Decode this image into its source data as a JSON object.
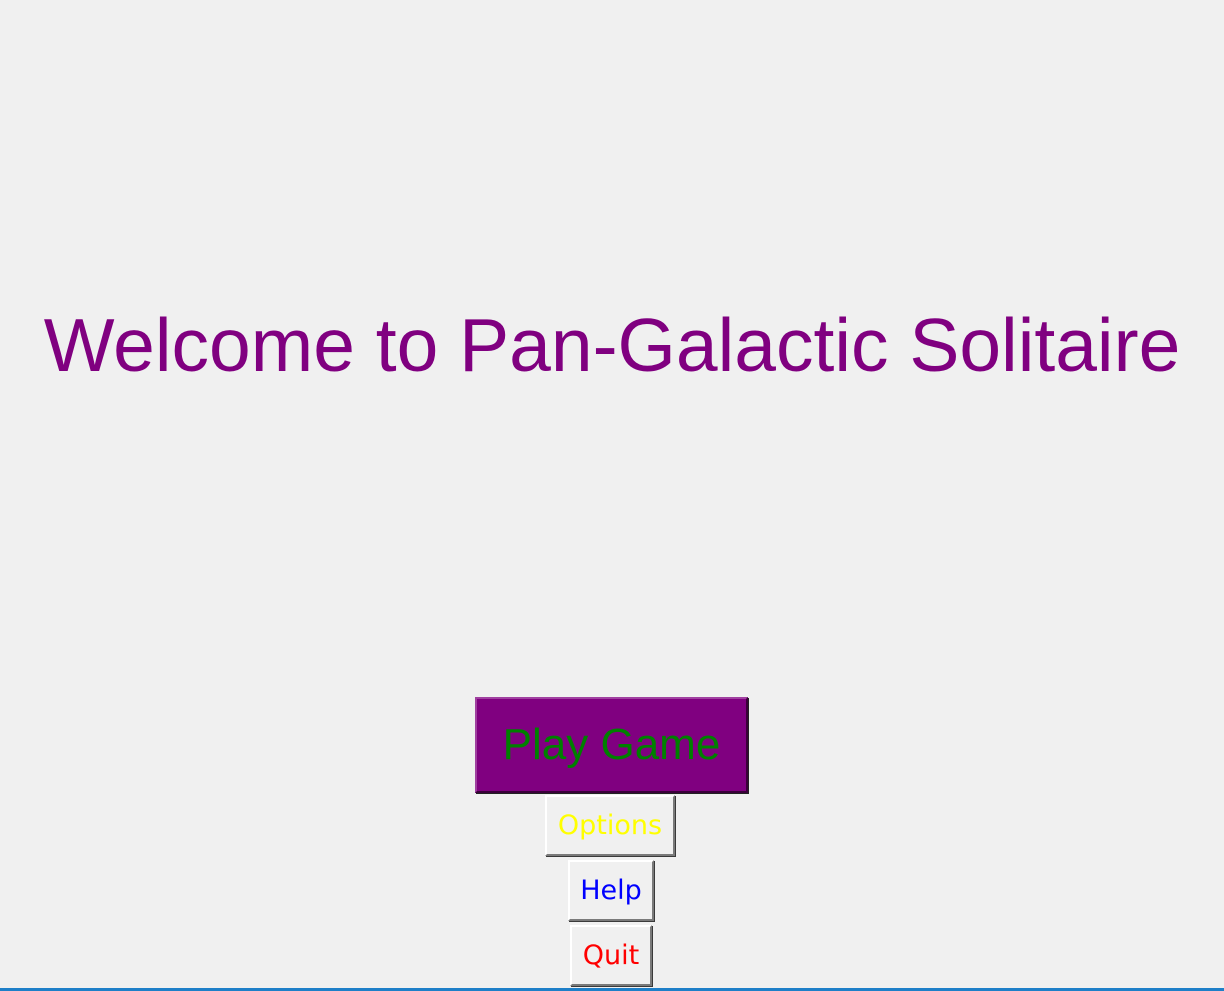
{
  "title": {
    "text": "Welcome to Pan-Galactic Solitaire",
    "color": "#800080"
  },
  "menu": {
    "play": {
      "label": "Play Game",
      "background": "#800080",
      "text_color": "#008000"
    },
    "options": {
      "label": "Options",
      "text_color": "#ffff00"
    },
    "help": {
      "label": "Help",
      "text_color": "#0000ff"
    },
    "quit": {
      "label": "Quit",
      "text_color": "#ff0000"
    }
  },
  "colors": {
    "window_background": "#f0f0f0",
    "window_border": "#1e7fc8"
  }
}
